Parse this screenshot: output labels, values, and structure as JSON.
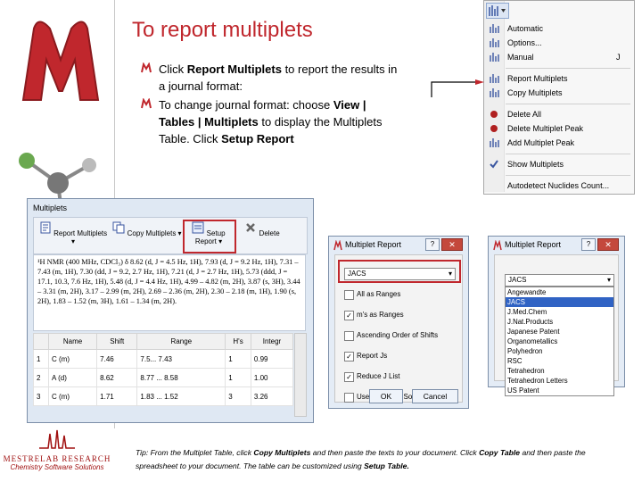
{
  "slide": {
    "title": "To report multiplets",
    "bullets": [
      [
        {
          "t": "Click "
        },
        {
          "t": "Report Multiplets",
          "b": true
        },
        {
          "t": " to report the results in a journal format:"
        }
      ],
      [
        {
          "t": "To change journal format: choose "
        },
        {
          "t": "View | Tables | Multiplets",
          "b": true
        },
        {
          "t": " to display the Multiplets Table. Click "
        },
        {
          "t": "Setup Report",
          "b": true
        }
      ]
    ],
    "tip": [
      {
        "t": "Tip: From the Multiplet Table, click "
      },
      {
        "t": "Copy Multiplets",
        "b": true
      },
      {
        "t": " and then paste the texts to your document.  Click "
      },
      {
        "t": "Copy Table",
        "b": true
      },
      {
        "t": " and then paste the spreadsheet to your document.  The table can be customized using "
      },
      {
        "t": "Setup Table.",
        "b": true
      }
    ]
  },
  "brand": {
    "company": "MESTRELAB RESEARCH",
    "tagline": "Chemistry Software Solutions"
  },
  "menu": {
    "items": [
      {
        "label": "Automatic",
        "icon": "auto-multiplet-icon",
        "key": ""
      },
      {
        "label": "Options...",
        "icon": "options-icon",
        "key": ""
      },
      {
        "label": "Manual",
        "icon": "manual-multiplet-icon",
        "key": "J"
      },
      {
        "sep": true
      },
      {
        "label": "Report Multiplets",
        "icon": "report-multiplets-icon",
        "key": ""
      },
      {
        "label": "Copy Multiplets",
        "icon": "copy-multiplets-icon",
        "key": ""
      },
      {
        "sep": true
      },
      {
        "label": "Delete All",
        "icon": "delete-all-icon",
        "key": ""
      },
      {
        "label": "Delete Multiplet Peak",
        "icon": "delete-peak-icon",
        "key": ""
      },
      {
        "label": "Add Multiplet Peak",
        "icon": "add-peak-icon",
        "key": ""
      },
      {
        "sep": true
      },
      {
        "label": "Show Multiplets",
        "icon": "checkmark-icon",
        "key": ""
      },
      {
        "sep": true
      },
      {
        "label": "Autodetect Nuclides Count...",
        "icon": "",
        "key": ""
      }
    ]
  },
  "multiplets_window": {
    "title": "Multiplets",
    "toolbar": [
      "Report Multiplets",
      "Copy Multiplets",
      "Setup Report",
      "Delete"
    ],
    "report_text": "¹H NMR (400 MHz, CDCl₃) δ 8.62 (d, J = 4.5 Hz, 1H), 7.93 (d, J = 9.2 Hz, 1H), 7.31 – 7.43 (m, 1H), 7.30 (dd, J = 9.2, 2.7 Hz, 1H), 7.21 (d, J = 2.7 Hz, 1H), 5.73 (ddd, J = 17.1, 10.3, 7.6 Hz, 1H), 5.48 (d, J = 4.4 Hz, 1H), 4.99 – 4.82 (m, 2H), 3.87 (s, 3H), 3.44 – 3.31 (m, 2H), 3.17 – 2.99 (m, 2H), 2.69 – 2.36 (m, 2H), 2.30 – 2.18 (m, 1H), 1.90 (s, 2H), 1.83 – 1.52 (m, 3H), 1.61 – 1.34 (m, 2H).",
    "columns": [
      "Name",
      "Shift",
      "Range",
      "H's",
      "Integr"
    ],
    "rows": [
      {
        "idx": "1",
        "name": "C (m)",
        "shift": "7.46",
        "range": "7.5... 7.43",
        "h": "1",
        "integ": "0.99"
      },
      {
        "idx": "2",
        "name": "A (d)",
        "shift": "8.62",
        "range": "8.77 ... 8.58",
        "h": "1",
        "integ": "1.00"
      },
      {
        "idx": "3",
        "name": "C (m)",
        "shift": "1.71",
        "range": "1.83 ... 1.52",
        "h": "3",
        "integ": "3.26"
      }
    ]
  },
  "dialog1": {
    "title": "Multiplet Report",
    "journal": "JACS",
    "options": [
      {
        "label": "All as Ranges",
        "checked": false
      },
      {
        "label": "m's as Ranges",
        "checked": true
      },
      {
        "label": "Ascending Order of Shifts",
        "checked": false
      },
      {
        "label": "Report Js",
        "checked": true
      },
      {
        "label": "Reduce J List",
        "checked": true
      },
      {
        "label": "Use Extended Solvent Names",
        "checked": false
      }
    ],
    "ok": "OK",
    "cancel": "Cancel"
  },
  "dialog2": {
    "title": "Multiplet Report",
    "journal": "JACS",
    "journals": [
      "Angewandte",
      "JACS",
      "J.Med.Chem",
      "J.Nat.Products",
      "Japanese Patent",
      "Organometallics",
      "Polyhedron",
      "RSC",
      "Tetrahedron",
      "Tetrahedron Letters",
      "US Patent"
    ]
  },
  "colors": {
    "accent": "#c0272d",
    "brand_red": "#a01010"
  }
}
